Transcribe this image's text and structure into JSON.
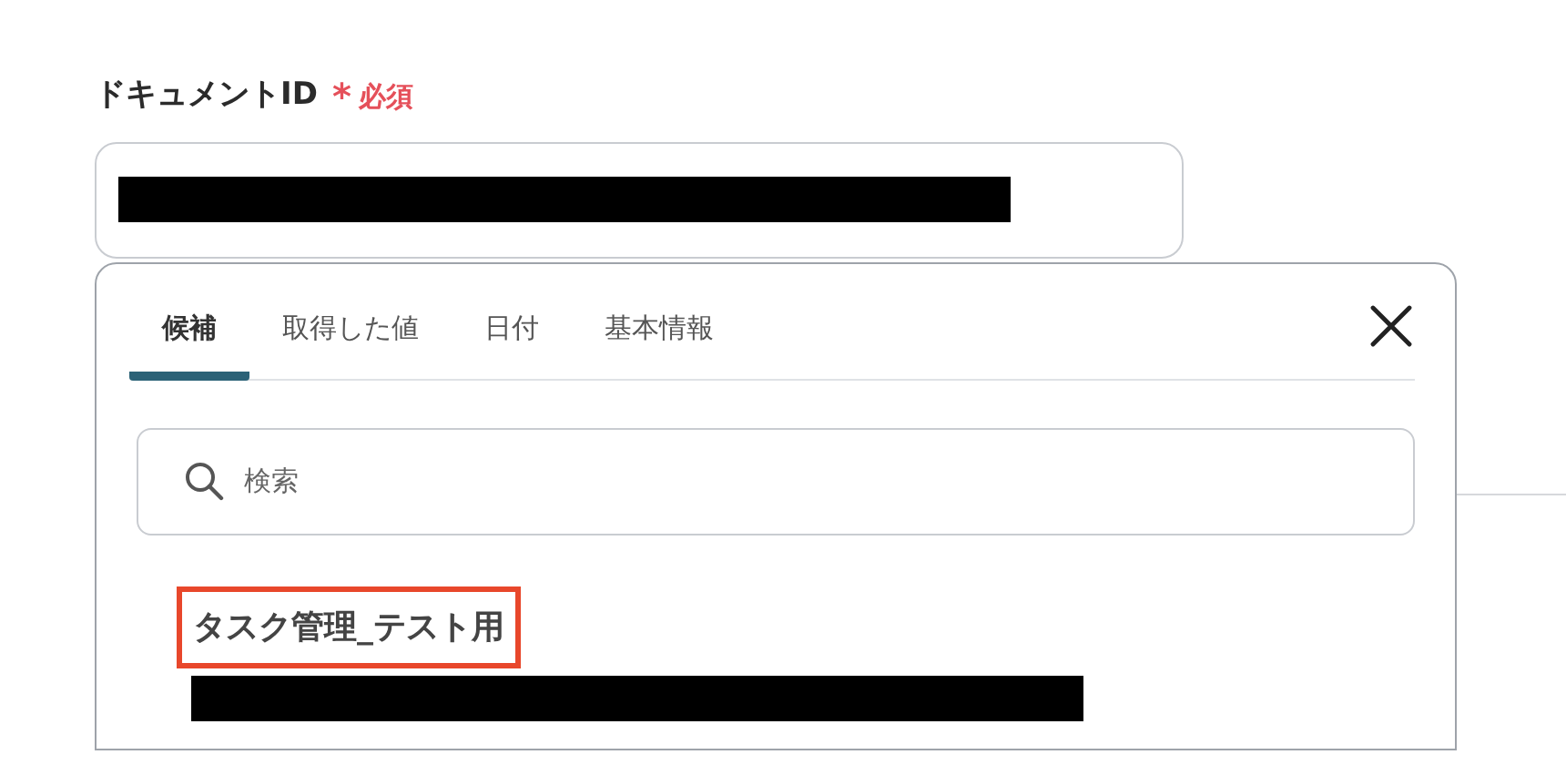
{
  "field": {
    "label": "ドキュメントID",
    "required_mark": "*",
    "required_text": "必須",
    "redacted": true
  },
  "panel": {
    "tabs": [
      {
        "label": "候補",
        "selected": true
      },
      {
        "label": "取得した値",
        "selected": false
      },
      {
        "label": "日付",
        "selected": false
      },
      {
        "label": "基本情報",
        "selected": false
      }
    ],
    "search": {
      "placeholder": "検索"
    },
    "items": [
      {
        "title": "タスク管理_テスト用",
        "highlighted": true,
        "redacted": true
      }
    ]
  }
}
